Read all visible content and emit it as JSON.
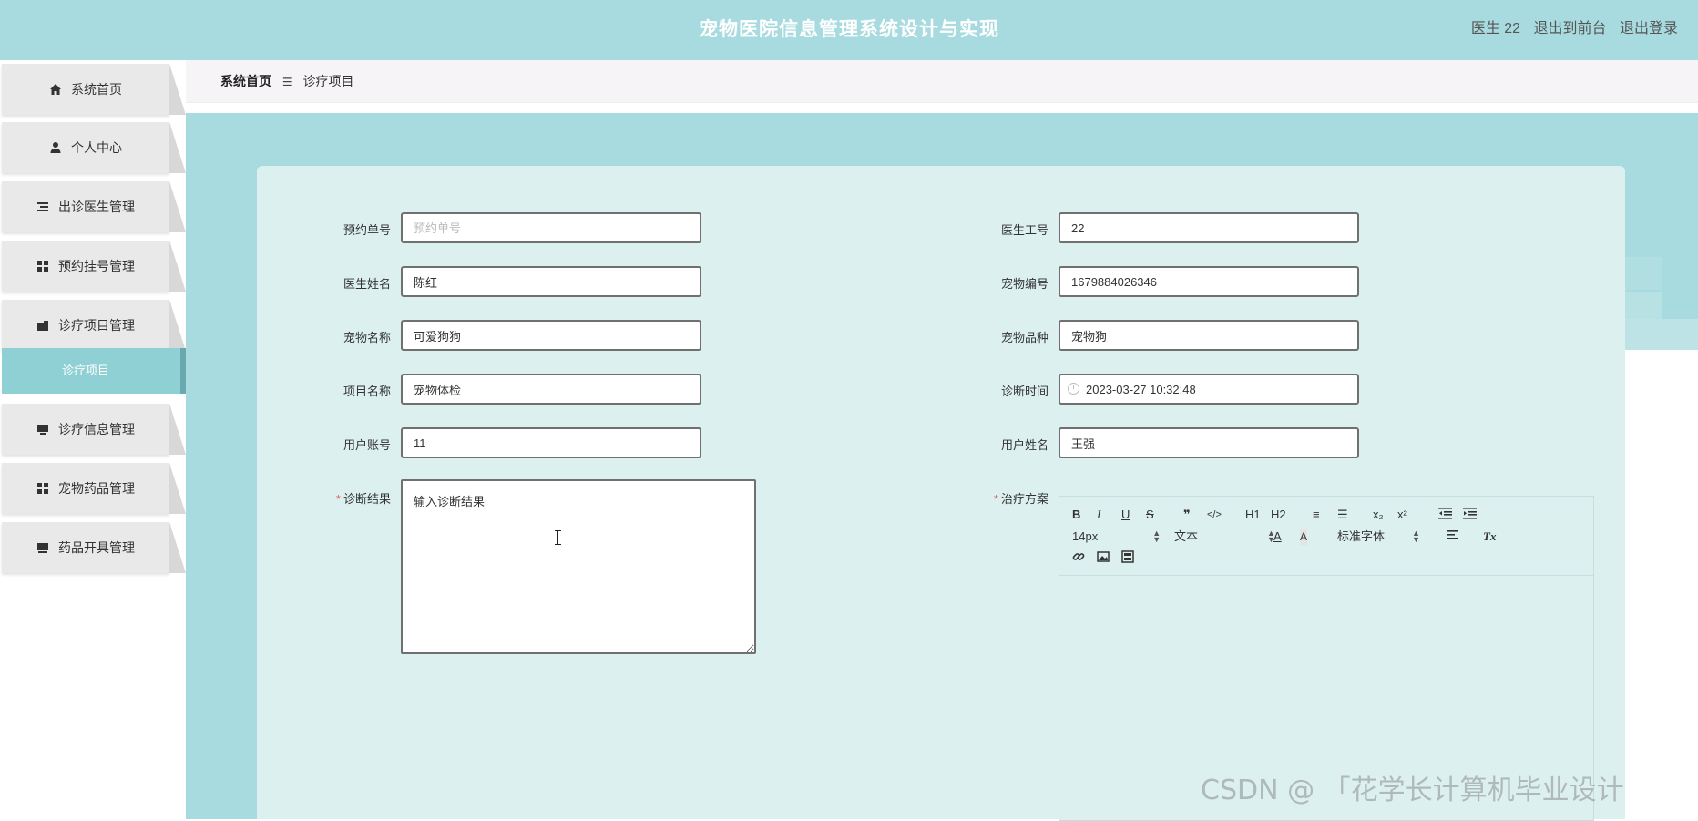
{
  "header": {
    "title": "宠物医院信息管理系统设计与实现",
    "user": "医生 22",
    "back_front": "退出到前台",
    "logout": "退出登录"
  },
  "sidebar": {
    "items": [
      {
        "label": "系统首页",
        "icon": "home-icon"
      },
      {
        "label": "个人中心",
        "icon": "user-icon"
      },
      {
        "label": "出诊医生管理",
        "icon": "list-icon"
      },
      {
        "label": "预约挂号管理",
        "icon": "grid-icon"
      },
      {
        "label": "诊疗项目管理",
        "icon": "briefcase-icon"
      },
      {
        "label": "诊疗信息管理",
        "icon": "monitor-icon"
      },
      {
        "label": "宠物药品管理",
        "icon": "grid-icon"
      },
      {
        "label": "药品开具管理",
        "icon": "monitor-icon"
      }
    ],
    "active_sub": "诊疗项目"
  },
  "breadcrumb": {
    "home": "系统首页",
    "sep": "☰",
    "current": "诊疗项目"
  },
  "form": {
    "appointment_no": {
      "label": "预约单号",
      "value": "",
      "placeholder": "预约单号"
    },
    "doctor_id": {
      "label": "医生工号",
      "value": "22"
    },
    "doctor_name": {
      "label": "医生姓名",
      "value": "陈红"
    },
    "pet_no": {
      "label": "宠物编号",
      "value": "1679884026346"
    },
    "pet_name": {
      "label": "宠物名称",
      "value": "可爱狗狗"
    },
    "pet_breed": {
      "label": "宠物品种",
      "value": "宠物狗"
    },
    "item_name": {
      "label": "项目名称",
      "value": "宠物体检"
    },
    "diagnosis_time": {
      "label": "诊断时间",
      "value": "2023-03-27 10:32:48"
    },
    "user_account": {
      "label": "用户账号",
      "value": "11"
    },
    "user_name": {
      "label": "用户姓名",
      "value": "王强"
    },
    "diagnosis_result": {
      "label": "诊断结果",
      "value": "输入诊断结果",
      "required": "*"
    },
    "treatment_plan": {
      "label": "治疗方案",
      "required": "*"
    }
  },
  "editor": {
    "font_size": "14px",
    "paragraph": "文本",
    "font_family": "标准字体",
    "buttons": [
      "B",
      "I",
      "U",
      "S",
      "❞",
      "</>",
      "H1",
      "H2",
      "≡",
      "☰",
      "x₂",
      "x²"
    ]
  },
  "watermark": "CSDN @ 「花学长计算机毕业设计"
}
